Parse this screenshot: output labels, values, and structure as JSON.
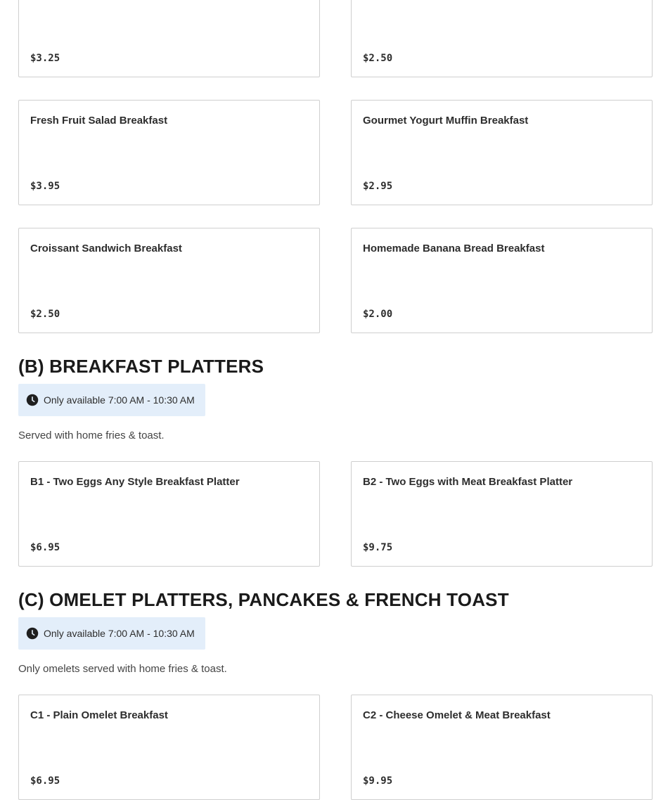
{
  "top_items": [
    {
      "name": "",
      "price": "$3.25"
    },
    {
      "name": "",
      "price": "$2.50"
    },
    {
      "name": "Fresh Fruit Salad Breakfast",
      "price": "$3.95"
    },
    {
      "name": "Gourmet Yogurt Muffin Breakfast",
      "price": "$2.95"
    },
    {
      "name": "Croissant Sandwich Breakfast",
      "price": "$2.50"
    },
    {
      "name": "Homemade Banana Bread Breakfast",
      "price": "$2.00"
    }
  ],
  "section_b": {
    "title": "(B) Breakfast Platters",
    "availability": "Only available 7:00 AM - 10:30 AM",
    "description": "Served with home fries & toast.",
    "items": [
      {
        "name": "B1 - Two Eggs Any Style Breakfast Platter",
        "price": "$6.95"
      },
      {
        "name": "B2 - Two Eggs with Meat Breakfast Platter",
        "price": "$9.75"
      }
    ]
  },
  "section_c": {
    "title": "(C) Omelet Platters, Pancakes & French Toast",
    "availability": "Only available 7:00 AM - 10:30 AM",
    "description": "Only omelets served with home fries & toast.",
    "items": [
      {
        "name": "C1 - Plain Omelet Breakfast",
        "price": "$6.95"
      },
      {
        "name": "C2 - Cheese Omelet & Meat Breakfast",
        "price": "$9.95"
      }
    ]
  },
  "icons": {
    "availability": "clock-icon"
  },
  "colors": {
    "availability_bg": "#e3eefa",
    "card_border": "#cfcfcf",
    "text": "#2d2d2d"
  }
}
